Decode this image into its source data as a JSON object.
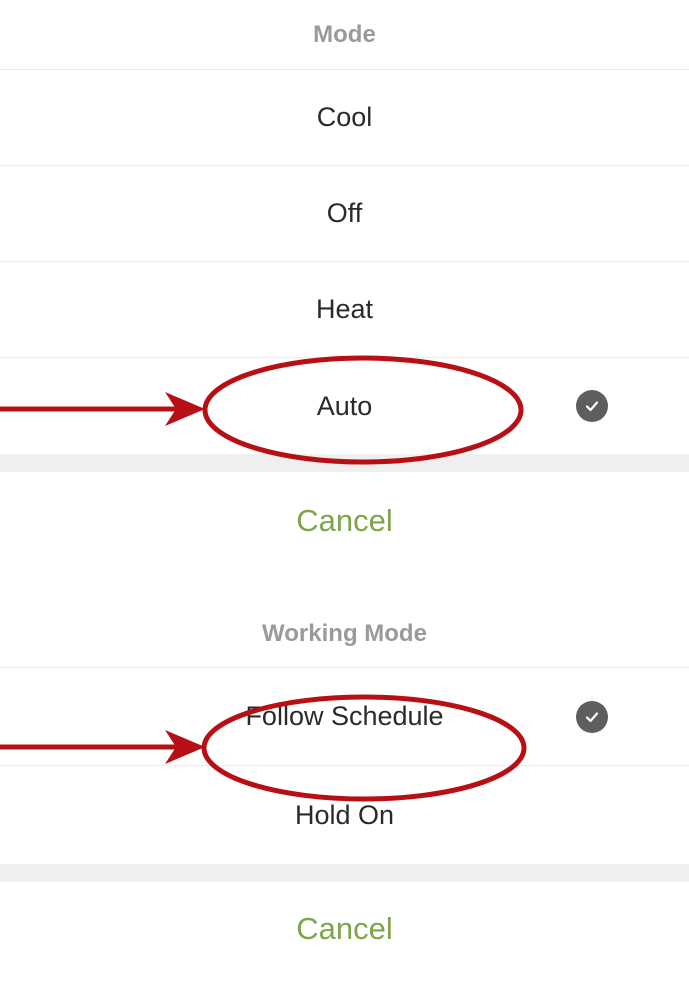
{
  "mode_sheet": {
    "title": "Mode",
    "options": [
      {
        "label": "Cool",
        "selected": false
      },
      {
        "label": "Off",
        "selected": false
      },
      {
        "label": "Heat",
        "selected": false
      },
      {
        "label": "Auto",
        "selected": true
      }
    ],
    "cancel_label": "Cancel"
  },
  "working_mode_sheet": {
    "title": "Working Mode",
    "options": [
      {
        "label": "Follow Schedule",
        "selected": true
      },
      {
        "label": "Hold On",
        "selected": false
      }
    ],
    "cancel_label": "Cancel"
  },
  "colors": {
    "accent_cancel": "#7fa54a",
    "annotation_red": "#b80f14",
    "check_badge": "#5e5e5e"
  },
  "icons": {
    "selected": "check-circle-icon",
    "annotation": "red-arrow-icon"
  }
}
